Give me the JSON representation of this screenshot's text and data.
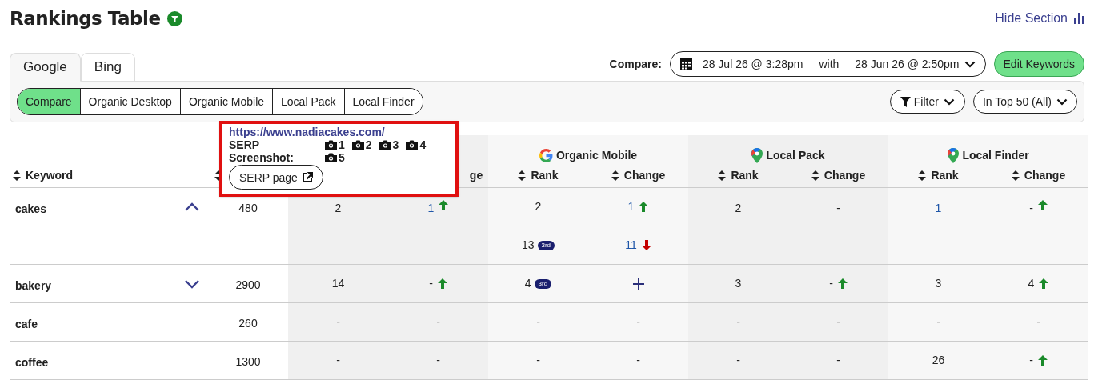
{
  "title": "Rankings Table",
  "hide_section": "Hide Section",
  "engine_tabs": [
    {
      "label": "Google",
      "selected": true
    },
    {
      "label": "Bing",
      "selected": false
    }
  ],
  "view_tabs": [
    {
      "label": "Compare",
      "selected": true
    },
    {
      "label": "Organic Desktop",
      "selected": false
    },
    {
      "label": "Organic Mobile",
      "selected": false
    },
    {
      "label": "Local Pack",
      "selected": false
    },
    {
      "label": "Local Finder",
      "selected": false
    }
  ],
  "compare": {
    "label": "Compare:",
    "from": "28 Jul 26 @ 3:28pm",
    "with": "with",
    "to": "28 Jun 26 @ 2:50pm"
  },
  "edit_keywords": "Edit Keywords",
  "filter": "Filter",
  "top_filter": "In Top 50 (All)",
  "header": {
    "keyword": "Keyword",
    "groups": [
      {
        "columns": [
          {},
          {
            "label": "ge"
          }
        ]
      },
      {
        "label": "Organic Mobile",
        "kind": "search",
        "columns": [
          {
            "label": "Rank"
          },
          {
            "label": "Change"
          }
        ]
      },
      {
        "label": "Local Pack",
        "kind": "maps",
        "columns": [
          {
            "label": "Rank"
          },
          {
            "label": "Change"
          }
        ]
      },
      {
        "label": "Local Finder",
        "kind": "maps",
        "columns": [
          {
            "label": "Rank"
          },
          {
            "label": "Change"
          }
        ]
      }
    ]
  },
  "rows": [
    {
      "keyword": "cakes",
      "expanded": true,
      "volume": "480",
      "cells": [
        {
          "text": "2"
        },
        {
          "text": "1",
          "link": true,
          "up": true
        },
        {
          "text": "2"
        },
        {
          "text": "1",
          "link": true,
          "up": true
        },
        {
          "text": "2"
        },
        {
          "text": "-"
        },
        {
          "text": "1",
          "link": true
        },
        {
          "text": "-",
          "up": true
        }
      ],
      "sub_cells": [
        {},
        {},
        {
          "text": "13",
          "badge": "3rd"
        },
        {
          "text": "11",
          "link": true,
          "down": true
        },
        {},
        {},
        {},
        {}
      ]
    },
    {
      "keyword": "bakery",
      "expanded": false,
      "volume": "2900",
      "cells": [
        {
          "text": "14"
        },
        {
          "text": "-",
          "up": true
        },
        {
          "text": "4",
          "badge": "3rd"
        },
        {
          "kind": "new"
        },
        {
          "text": "3"
        },
        {
          "text": "-",
          "up": true
        },
        {
          "text": "3"
        },
        {
          "text": "4",
          "up": true
        }
      ]
    },
    {
      "keyword": "cafe",
      "volume": "260",
      "cells": [
        {
          "text": "-"
        },
        {
          "text": "-"
        },
        {
          "text": "-"
        },
        {
          "text": "-"
        },
        {
          "text": "-"
        },
        {
          "text": "-"
        },
        {
          "text": "-"
        },
        {
          "text": "-"
        }
      ]
    },
    {
      "keyword": "coffee",
      "volume": "1300",
      "cells": [
        {
          "text": "-"
        },
        {
          "text": "-"
        },
        {
          "text": "-"
        },
        {
          "text": "-"
        },
        {
          "text": "-"
        },
        {
          "text": "-"
        },
        {
          "text": "26"
        },
        {
          "text": "-",
          "up": true
        }
      ]
    }
  ],
  "tooltip": {
    "url": "https://www.nadiacakes.com/",
    "serp_label": "SERP",
    "screenshot_label": "Screenshot:",
    "screenshots": [
      [
        "1",
        "2",
        "3",
        "4"
      ],
      [
        "5"
      ]
    ],
    "button": "SERP page"
  }
}
